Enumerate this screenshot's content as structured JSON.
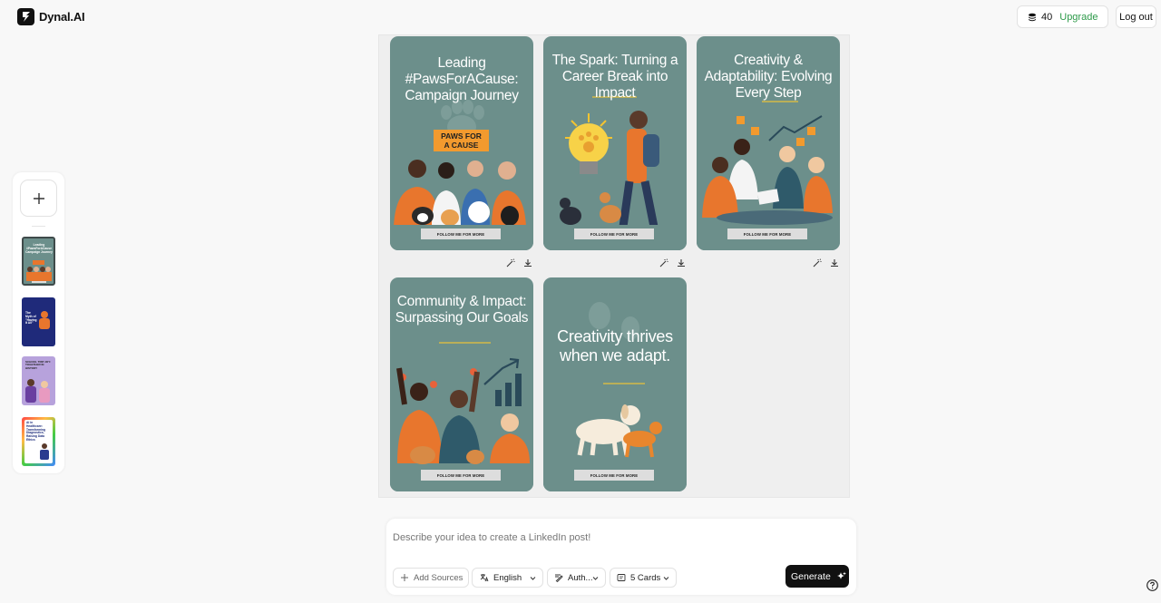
{
  "brand": {
    "name": "Dynal.AI"
  },
  "header": {
    "credits": "40",
    "upgrade_label": "Upgrade",
    "logout_label": "Log out"
  },
  "sidebar": {
    "thumbnails": [
      {
        "text": "Leading #PawsForACause Campaign Journey",
        "color": "#6c8f8b"
      },
      {
        "text": "The Myth of \"Having It All\"",
        "color": "#1f2a7a"
      },
      {
        "text": "SCHOOL TRIP JOY: TOGETHER IN HISTORY",
        "color": "#a98ad0"
      },
      {
        "text": "AI in Healthcare: Transforming Diagnostics, Raising Data Ethics",
        "color": "#2b3b8f"
      }
    ]
  },
  "cards": [
    {
      "title": "Leading #PawsForACause: Campaign Journey",
      "badge": "PAWS FOR A CAUSE",
      "follow": "FOLLOW ME FOR MORE"
    },
    {
      "title": "The Spark: Turning a Career Break into Impact",
      "follow": "FOLLOW ME FOR MORE"
    },
    {
      "title": "Creativity & Adaptability: Evolving Every Step",
      "follow": "FOLLOW ME FOR MORE"
    },
    {
      "title": "Community & Impact: Surpassing Our Goals",
      "follow": "FOLLOW ME FOR MORE"
    },
    {
      "title": "Creativity thrives when we adapt.",
      "follow": "FOLLOW ME FOR MORE"
    }
  ],
  "composer": {
    "placeholder": "Describe your idea to create a LinkedIn post!",
    "add_sources": "Add Sources",
    "language": "English",
    "tone": "Auth...",
    "cards_count": "5 Cards",
    "generate_label": "Generate"
  },
  "colors": {
    "card_bg": "#6c8f8b",
    "accent_orange": "#e8762d",
    "upgrade_green": "#2e9a4a"
  }
}
